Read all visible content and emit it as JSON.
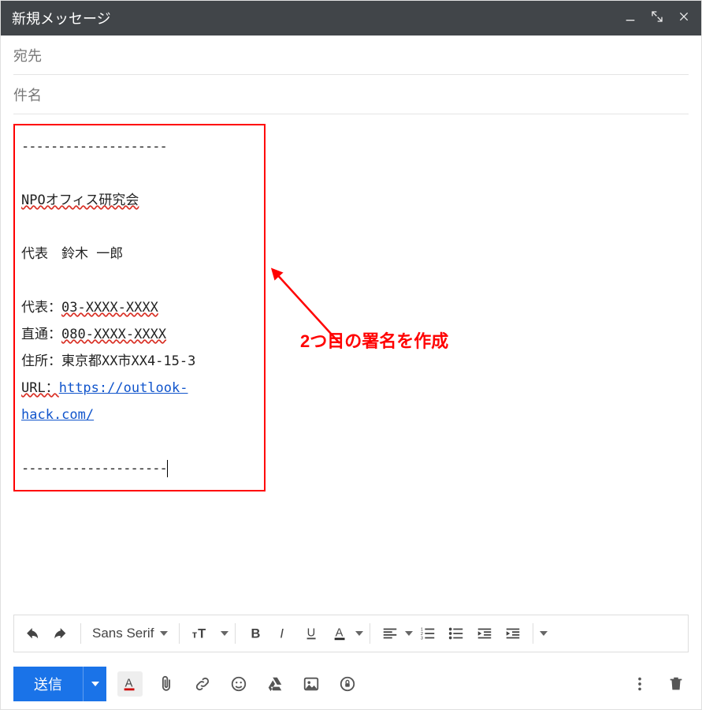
{
  "titlebar": {
    "title": "新規メッセージ"
  },
  "fields": {
    "to_label": "宛先",
    "subject_label": "件名"
  },
  "signature": {
    "dash_top": "--------------------",
    "org": "NPOオフィス研究会",
    "name_line": "代表　鈴木 一郎",
    "tel_main_label": "代表：",
    "tel_main_value": "03-XXXX-XXXX",
    "tel_direct_label": "直通：",
    "tel_direct_value": "080-XXXX-XXXX",
    "address_label": "住所：",
    "address_value": "東京都XX市XX4-15-3",
    "url_label": "URL：",
    "url_value": "https://outlook-hack.com/",
    "dash_bottom": "--------------------"
  },
  "annotation": {
    "text": "2つ目の署名を作成"
  },
  "formatting": {
    "font_name": "Sans Serif"
  },
  "actions": {
    "send_label": "送信"
  }
}
